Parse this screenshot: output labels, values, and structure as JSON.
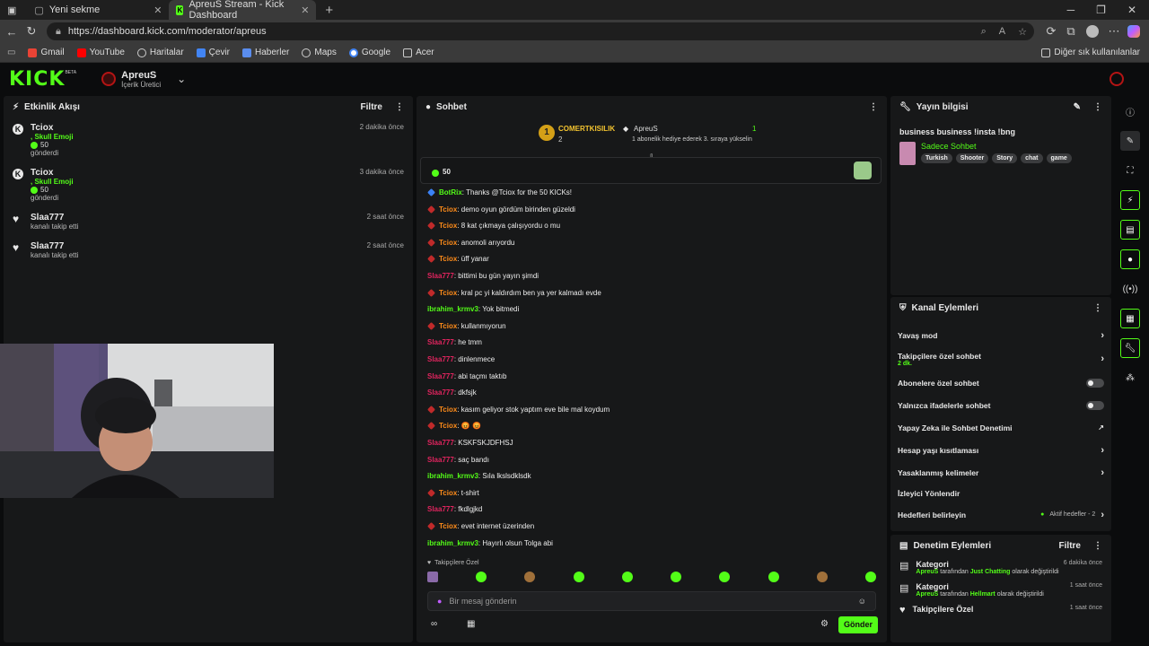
{
  "browser": {
    "tabs": [
      {
        "label": "Yeni sekme",
        "active": false
      },
      {
        "label": "ApreuS Stream - Kick Dashboard",
        "active": true
      }
    ],
    "url": "https://dashboard.kick.com/moderator/apreus",
    "bookmarks": [
      "Gmail",
      "YouTube",
      "Haritalar",
      "Çevir",
      "Haberler",
      "Maps",
      "Google",
      "Acer"
    ],
    "other_bookmarks": "Diğer sık kullanılanlar"
  },
  "header": {
    "logo": "KICK",
    "beta": "BETA",
    "channel_name": "ApreuS",
    "channel_role": "İçerik Üretici"
  },
  "activity": {
    "title": "Etkinlik Akışı",
    "filter": "Filtre",
    "items": [
      {
        "name": "Tciox",
        "sub": ", Skull Emoji",
        "amount": "50",
        "desc": "gönderdi",
        "time": "2 dakika önce"
      },
      {
        "name": "Tciox",
        "sub": ", Skull Emoji",
        "amount": "50",
        "desc": "gönderdi",
        "time": "3 dakika önce"
      },
      {
        "name": "Slaa777",
        "desc": "kanalı takip etti",
        "time": "2 saat önce"
      },
      {
        "name": "Slaa777",
        "desc": "kanalı takip etti",
        "time": "2 saat önce"
      }
    ]
  },
  "chat": {
    "title": "Sohbet",
    "pinned": {
      "rank": "1",
      "user": "COMERTKISILIK",
      "count": "2",
      "top_user": "ApreuS",
      "top_count": "1",
      "note": "1 abonelik hediye ederek 3. sıraya yükselin"
    },
    "kicks_amount": "50",
    "messages": [
      {
        "user": "BotRix",
        "text": ": Thanks @Tciox for the 50 KICKs!",
        "color": "#53fc18"
      },
      {
        "user": "Tciox",
        "text": ": demo oyun gördüm birinden güzeldi",
        "color": "#ff8c1a"
      },
      {
        "user": "Tciox",
        "text": ": 8 kat çıkmaya çalışıyordu o mu",
        "color": "#ff8c1a"
      },
      {
        "user": "Tciox",
        "text": ": anomoli arıyordu",
        "color": "#ff8c1a"
      },
      {
        "user": "Tciox",
        "text": ": üff yanar",
        "color": "#ff8c1a"
      },
      {
        "user": "Slaa777",
        "text": ": bittimi bu gün yayın şimdi",
        "color": "#e0245e"
      },
      {
        "user": "Tciox",
        "text": ": kral pc yi kaldırdım ben ya yer kalmadı evde",
        "color": "#ff8c1a"
      },
      {
        "user": "ibrahim_krmv3",
        "text": ": Yok bitmedi",
        "color": "#53fc18"
      },
      {
        "user": "Tciox",
        "text": ": kullanmıyorun",
        "color": "#ff8c1a"
      },
      {
        "user": "Slaa777",
        "text": ": he tmm",
        "color": "#e0245e"
      },
      {
        "user": "Slaa777",
        "text": ": dinlenmece",
        "color": "#e0245e"
      },
      {
        "user": "Slaa777",
        "text": ": abi taçmı taktıb",
        "color": "#e0245e"
      },
      {
        "user": "Slaa777",
        "text": ": dkfsjk",
        "color": "#e0245e"
      },
      {
        "user": "Tciox",
        "text": ": kasım geliyor stok yaptım eve bile mal koydum",
        "color": "#ff8c1a"
      },
      {
        "user": "Tciox",
        "text": ": 😡 😡",
        "color": "#ff8c1a"
      },
      {
        "user": "Slaa777",
        "text": ": KSKFSKJDFHSJ",
        "color": "#e0245e"
      },
      {
        "user": "Slaa777",
        "text": ": saç bandı",
        "color": "#e0245e"
      },
      {
        "user": "ibrahim_krmv3",
        "text": ": Sıla lkslsdklsdk",
        "color": "#53fc18"
      },
      {
        "user": "Tciox",
        "text": ": t-shirt",
        "color": "#ff8c1a"
      },
      {
        "user": "Slaa777",
        "text": ": fkdlgjkd",
        "color": "#e0245e"
      },
      {
        "user": "Tciox",
        "text": ": evet internet üzerinden",
        "color": "#ff8c1a"
      },
      {
        "user": "ibrahim_krmv3",
        "text": ": Hayırlı olsun Tolga abi",
        "color": "#53fc18"
      }
    ],
    "followers_only": "Takipçilere Özel",
    "placeholder": "Bir mesaj gönderin",
    "send": "Gönder"
  },
  "stream_info": {
    "title": "Yayın bilgisi",
    "stream_title": "business business !insta !bng",
    "category": "Sadece Sohbet",
    "tags": [
      "Turkish",
      "Shooter",
      "Story",
      "chat",
      "game"
    ]
  },
  "channel_actions": {
    "title": "Kanal Eylemleri",
    "slow_mode": "Yavaş mod",
    "followers_chat": "Takipçilere özel sohbet",
    "followers_duration": "2 dk.",
    "subs_chat": "Abonelere özel sohbet",
    "emotes_chat": "Yalnızca ifadelerle sohbet",
    "ai_moderation": "Yapay Zeka ile Sohbet Denetimi",
    "age_restriction": "Hesap yaşı kısıtlaması",
    "banned_words": "Yasaklanmış kelimeler",
    "raid": "İzleyici Yönlendir",
    "goals": "Hedefleri belirleyin",
    "goals_status": "Aktif hedefler - 2"
  },
  "mod_actions": {
    "title": "Denetim Eylemleri",
    "filter": "Filtre",
    "items": [
      {
        "title": "Kategori",
        "user": "ApreuS",
        "mid": " tarafından ",
        "value": "Just Chatting",
        "end": " olarak değiştirildi",
        "time": "6 dakika önce"
      },
      {
        "title": "Kategori",
        "user": "ApreuS",
        "mid": " tarafından ",
        "value": "Hellmart",
        "end": " olarak değiştirildi",
        "time": "1 saat önce"
      },
      {
        "title": "Takipçilere Özel",
        "time": "1 saat önce"
      }
    ]
  }
}
